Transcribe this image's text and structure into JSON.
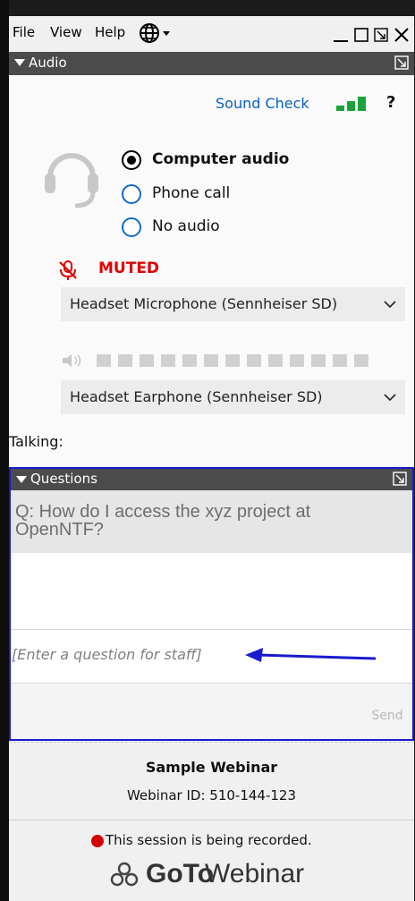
{
  "menubar": {
    "items": [
      "File",
      "View",
      "Help"
    ]
  },
  "audio": {
    "title": "Audio",
    "sound_check": "Sound Check",
    "help": "?",
    "options": [
      {
        "label": "Computer audio",
        "selected": true
      },
      {
        "label": "Phone call",
        "selected": false
      },
      {
        "label": "No audio",
        "selected": false
      }
    ],
    "muted_label": "MUTED",
    "microphone": "Headset Microphone (Sennheiser SD)",
    "speaker": "Headset Earphone (Sennheiser SD)",
    "talking_label": "Talking:"
  },
  "questions": {
    "title": "Questions",
    "latest_question": "Q: How do I access the xyz project at OpenNTF?",
    "input_placeholder": "[Enter a question for staff]",
    "send_label": "Send"
  },
  "footer": {
    "webinar_name": "Sample Webinar",
    "webinar_id": "Webinar ID: 510-144-123",
    "recording_notice": "This session is being recorded.",
    "brand_bold": "GoTo",
    "brand_light": "Webinar"
  },
  "colors": {
    "accent": "#0b5fc0",
    "muted": "#e00000",
    "signal": "#1aa33a",
    "questions_border": "#1a1acc",
    "record": "#d40000"
  },
  "icons": [
    "globe-icon",
    "minimize-icon",
    "restore-icon",
    "popout-icon",
    "close-icon",
    "signal-icon",
    "headset-icon",
    "mic-muted-icon",
    "speaker-icon",
    "chevron-down-icon",
    "arrow-icon",
    "gotowebinar-logo-icon"
  ]
}
